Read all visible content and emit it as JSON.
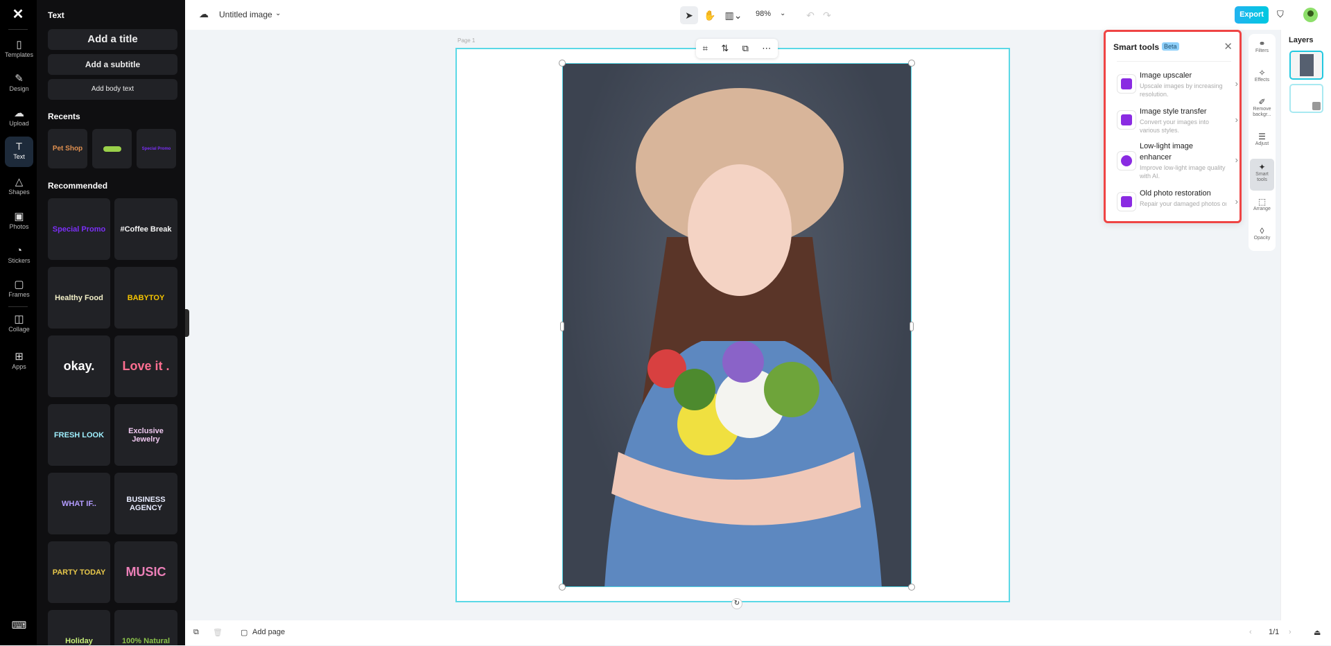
{
  "rail": {
    "items": [
      {
        "label": "Templates",
        "icon": "templates-icon",
        "glyph": "▯"
      },
      {
        "label": "Design",
        "icon": "design-icon",
        "glyph": "✎"
      },
      {
        "label": "Upload",
        "icon": "upload-icon",
        "glyph": "☁"
      },
      {
        "label": "Text",
        "icon": "text-icon",
        "glyph": "T"
      },
      {
        "label": "Shapes",
        "icon": "shapes-icon",
        "glyph": "△"
      },
      {
        "label": "Photos",
        "icon": "photos-icon",
        "glyph": "▣"
      },
      {
        "label": "Stickers",
        "icon": "stickers-icon",
        "glyph": "◔"
      },
      {
        "label": "Frames",
        "icon": "frames-icon",
        "glyph": "▢"
      },
      {
        "label": "Collage",
        "icon": "collage-icon",
        "glyph": "◫"
      },
      {
        "label": "Apps",
        "icon": "apps-icon",
        "glyph": "⊞"
      }
    ]
  },
  "panel": {
    "heading": "Text",
    "add_title": "Add a title",
    "add_subtitle": "Add a subtitle",
    "add_body": "Add body text",
    "recents_heading": "Recents",
    "recents": [
      "Pet Shop",
      "Bone sticker",
      "Special Promo"
    ],
    "recommended_heading": "Recommended",
    "recommended": [
      {
        "text": "Special Promo",
        "color": "#7b2ff7"
      },
      {
        "text": "#Coffee Break",
        "color": "#f5f5f5"
      },
      {
        "text": "Healthy Food",
        "color": "#f3f0c8"
      },
      {
        "text": "BABYTOY",
        "color": "#f5c400"
      },
      {
        "text": "okay.",
        "color": "#ffffff"
      },
      {
        "text": "Love it .",
        "color": "#ff6f91"
      },
      {
        "text": "FRESH LOOK",
        "color": "#9ff0ff"
      },
      {
        "text": "Exclusive Jewelry",
        "color": "#f0c8f0"
      },
      {
        "text": "WHAT IF..",
        "color": "#b49cff"
      },
      {
        "text": "BUSINESS AGENCY",
        "color": "#e8ecff"
      },
      {
        "text": "PARTY TODAY",
        "color": "#e8c84a"
      },
      {
        "text": "MUSIC",
        "color": "#ec80b8"
      },
      {
        "text": "Holiday",
        "color": "#c8f07a"
      },
      {
        "text": "100% Natural",
        "color": "#8bc34a"
      }
    ]
  },
  "topbar": {
    "doc_title": "Untitled image",
    "zoom": "98%",
    "export_label": "Export"
  },
  "canvas": {
    "page_label": "Page 1"
  },
  "smart_tools": {
    "title": "Smart tools",
    "badge": "Beta",
    "items": [
      {
        "name": "Image upscaler",
        "desc": "Upscale images by increasing resolution."
      },
      {
        "name": "Image style transfer",
        "desc": "Convert your images into various styles."
      },
      {
        "name": "Low-light image enhancer",
        "desc": "Improve low-light image quality with AI."
      },
      {
        "name": "Old photo restoration",
        "desc": "Repair your damaged photos or bring them new life with..."
      }
    ]
  },
  "strip": {
    "items": [
      {
        "label": "Filters",
        "glyph": "⚭"
      },
      {
        "label": "Effects",
        "glyph": "✧"
      },
      {
        "label": "Remove backgr...",
        "glyph": "✐"
      },
      {
        "label": "Adjust",
        "glyph": "☰"
      },
      {
        "label": "Smart tools",
        "glyph": "✦"
      },
      {
        "label": "Arrange",
        "glyph": "⬚"
      },
      {
        "label": "Opacity",
        "glyph": "◊"
      }
    ]
  },
  "layers": {
    "title": "Layers"
  },
  "bottombar": {
    "add_page": "Add page",
    "page_count": "1/1"
  }
}
